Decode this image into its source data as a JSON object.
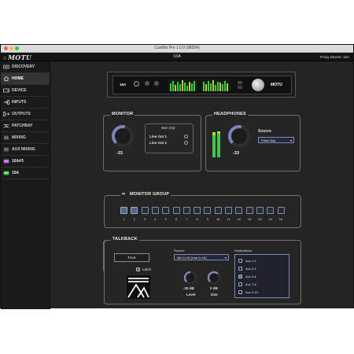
{
  "window": {
    "title": "CueMix Pro 1.0.0 (98254)",
    "logo": "MOTU",
    "device_name": "16A",
    "proxy_device": "Proxy Device: 16A"
  },
  "sidebar": {
    "items": [
      {
        "label": "DISCOVERY",
        "icon": "discovery-icon"
      },
      {
        "label": "HOME",
        "icon": "home-icon"
      },
      {
        "label": "DEVICE",
        "icon": "device-icon"
      },
      {
        "label": "INPUTS",
        "icon": "inputs-icon"
      },
      {
        "label": "OUTPUTS",
        "icon": "outputs-icon"
      },
      {
        "label": "PATCHBAY",
        "icon": "patchbay-icon"
      },
      {
        "label": "MIXING",
        "icon": "mixing-icon"
      },
      {
        "label": "AUX MIXING",
        "icon": "aux-mixing-icon"
      },
      {
        "label": "16A#3",
        "icon": "device-unit-icon"
      },
      {
        "label": "16A",
        "icon": "device-unit-icon"
      }
    ]
  },
  "hardware": {
    "model": "16A",
    "brand": "MOTU",
    "accent": "#ffffff"
  },
  "monitor": {
    "title": "MONITOR",
    "level": "-33",
    "level_fraction": 0.55,
    "group_title": "Mon Grp",
    "outputs": [
      "Line Out 1",
      "Line Out 2"
    ]
  },
  "headphones": {
    "title": "HEADPHONES",
    "level": "-33",
    "level_fraction": 0.55,
    "source_label": "Source",
    "source_value": "Patch Bay"
  },
  "monitor_group": {
    "title": "MONITOR GROUP",
    "buttons": [
      {
        "label": "1",
        "active": true
      },
      {
        "label": "2",
        "active": true
      },
      {
        "label": "3",
        "active": false
      },
      {
        "label": "4",
        "active": false
      },
      {
        "label": "5",
        "active": false
      },
      {
        "label": "6",
        "active": false
      },
      {
        "label": "7",
        "active": false
      },
      {
        "label": "8",
        "active": false
      },
      {
        "label": "9",
        "active": false
      },
      {
        "label": "10",
        "active": false
      },
      {
        "label": "11",
        "active": false
      },
      {
        "label": "12",
        "active": false
      },
      {
        "label": "13",
        "active": false
      },
      {
        "label": "14",
        "active": false
      },
      {
        "label": "15",
        "active": false
      },
      {
        "label": "16",
        "active": false
      }
    ]
  },
  "talkback": {
    "title": "TALKBACK",
    "talk_button": "TALK",
    "latch_label": "Latch",
    "source_label": "Source:",
    "source_value": "Mic In 16 (Line In 16)",
    "level_value": "-20 dB",
    "level_label": "Level",
    "dim_value": "0 dB",
    "dim_label": "Dim",
    "destinations_label": "Destinations:",
    "destinations": [
      {
        "label": "Aux 1-2",
        "checked": false
      },
      {
        "label": "Aux 3-4",
        "checked": false
      },
      {
        "label": "Aux 5-6",
        "checked": true
      },
      {
        "label": "Aux 7-8",
        "checked": false
      },
      {
        "label": "Aux 9-10",
        "checked": false
      }
    ]
  },
  "colors": {
    "accent": "#5b6384",
    "knob_arc": "#7b85b8",
    "meter_green": "#3cc84a",
    "meter_yellow": "#c8c83c"
  }
}
